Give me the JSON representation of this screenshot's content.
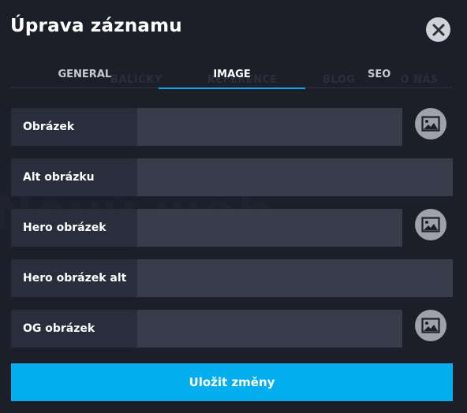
{
  "background": {
    "nav_items": [
      "BALÍČKY",
      "REFERENCE",
      "BLOG",
      "O NÁS"
    ],
    "hero_text": "Nový web"
  },
  "modal": {
    "title": "Úprava záznamu",
    "close_icon": "close-icon",
    "tabs": [
      {
        "label": "GENERAL",
        "active": false
      },
      {
        "label": "IMAGE",
        "active": true
      },
      {
        "label": "SEO",
        "active": false
      }
    ],
    "fields": [
      {
        "label": "Obrázek",
        "value": "",
        "has_picker": true,
        "picker_icon": "image-icon"
      },
      {
        "label": "Alt obrázku",
        "value": "",
        "has_picker": false
      },
      {
        "label": "Hero obrázek",
        "value": "",
        "has_picker": true,
        "picker_icon": "image-icon"
      },
      {
        "label": "Hero obrázek alt",
        "value": "",
        "has_picker": false
      },
      {
        "label": "OG obrázek",
        "value": "",
        "has_picker": true,
        "picker_icon": "image-icon"
      }
    ],
    "submit_label": "Uložit změny"
  },
  "colors": {
    "background": "#1c1e29",
    "accent": "#03aeee",
    "label_bg": "#2a2d3b",
    "input_bg": "#393c4a"
  }
}
